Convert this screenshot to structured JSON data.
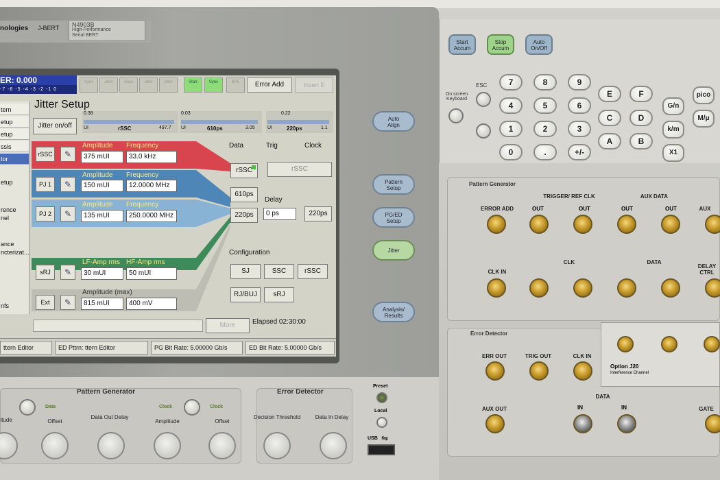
{
  "brand": {
    "name": "nologies",
    "product": "J-BERT",
    "model": "N4903B",
    "model_sub": "High-Performance",
    "serial_line": "Serial BERT"
  },
  "screen": {
    "ber_text": "ER: 0.000",
    "scale_text": "-7 -6 -5 -4 -3 -2 -1 0",
    "tabs": [
      "Sync",
      "Jitter",
      "Data",
      "Jitter",
      "Jitter",
      "Start",
      "Sync",
      "BPE"
    ],
    "error_add": "Error Add",
    "insert_label": "Insert E",
    "side_items": [
      "tern",
      "etup",
      "etup",
      "ssis",
      "tor",
      "etup",
      "rence",
      "nel",
      "ance",
      "ncterizat...",
      "nfs"
    ],
    "title": "Jitter Setup",
    "jitter_onoff": "Jitter on/off",
    "gauges": [
      {
        "lo": "0.38",
        "ui": "UI",
        "mid": "rSSC",
        "hi": "497.7"
      },
      {
        "lo": "0.03",
        "ui": "UI",
        "mid": "610ps",
        "hi": "3.05"
      },
      {
        "lo": "0.22",
        "ui": "UI",
        "mid": "220ps",
        "hi": "1.1"
      }
    ],
    "rows": [
      {
        "btn": "rSSC",
        "h1": "Amplitude",
        "h2": "Frequency",
        "v1": "375 mUI",
        "v2": "33.0 kHz",
        "color": "#d9454f"
      },
      {
        "btn": "PJ 1",
        "h1": "Amplitude",
        "h2": "Frequency",
        "v1": "150 mUI",
        "v2": "12.0000 MHz",
        "color": "#4f86b8"
      },
      {
        "btn": "PJ 2",
        "h1": "Amplitude",
        "h2": "Frequency",
        "v1": "135 mUI",
        "v2": "250.0000 MHz",
        "color": "#88b3d4"
      },
      {
        "btn": "sRJ",
        "h1": "LF-Amp rms",
        "h2": "HF-Amp rms",
        "v1": "30 mUI",
        "v2": "50 mUI",
        "color": "#3d8a5a"
      },
      {
        "btn": "Ext",
        "h1": "Amplitude (max)",
        "h2": "",
        "v1": "815 mUI",
        "v2": "400 mV",
        "color": "#bdbdb3"
      }
    ],
    "data_label": "Data",
    "trig_label": "Trig",
    "clock_label": "Clock",
    "rssc_btn": "rSSC",
    "rssc_wide": "rSSC",
    "ps610": "610ps",
    "ps220": "220ps",
    "delay_label": "Delay",
    "delay_value": "0 ps",
    "ps220b": "220ps",
    "configuration": "Configuration",
    "config_btns": [
      "SJ",
      "SSC",
      "rSSC",
      "RJ/BUJ",
      "sRJ"
    ],
    "more_btn": "More",
    "elapsed": "Elapsed 02:30:00",
    "status": [
      "ttern Editor",
      "ED Pttrn: ttern Editor",
      "PG Bit Rate: 5.00000 Gb/s",
      "ED Bit Rate: 5.00000 Gb/s"
    ]
  },
  "side_buttons": [
    {
      "label1": "Auto",
      "label2": "Align"
    },
    {
      "label1": "Pattern",
      "label2": "Setup"
    },
    {
      "label1": "PG/ED",
      "label2": "Setup"
    },
    {
      "label1": "Jitter",
      "label2": ""
    },
    {
      "label1": "Analysis/",
      "label2": "Results"
    }
  ],
  "top_buttons": [
    {
      "label1": "Start",
      "label2": "Accum"
    },
    {
      "label1": "Stop",
      "label2": "Accum"
    },
    {
      "label1": "Auto",
      "label2": "On/Off"
    }
  ],
  "keypad": {
    "numbers": [
      "7",
      "8",
      "9",
      "4",
      "5",
      "6",
      "1",
      "2",
      "3",
      "0",
      ".",
      "+/-"
    ],
    "hex": [
      "E",
      "F",
      "C",
      "D",
      "A",
      "B"
    ],
    "units": [
      "G/n",
      "k/m",
      "X1"
    ],
    "right": [
      "pico",
      "M/μ"
    ],
    "onscreen": "On screen Keyboard",
    "esc": "ESC"
  },
  "pattern_generator": {
    "title": "Pattern Generator",
    "labels": [
      "ERROR ADD",
      "TRIGGER/ REF CLK",
      "AUX DATA",
      "AUX",
      "CLK IN",
      "CLK",
      "DATA",
      "DELAY CTRL"
    ],
    "out": "OUT"
  },
  "error_detector": {
    "title": "Error Detector",
    "labels": [
      "ERR OUT",
      "TRIG OUT",
      "CLK IN",
      "AUX OUT",
      "DATA",
      "GATE"
    ],
    "in": "IN",
    "option": "Option J20",
    "option_sub": "Interference Channel"
  },
  "lower": {
    "pg_title": "Pattern Generator",
    "ed_title": "Error Detector",
    "knobs": [
      "Amplitude",
      "Offset",
      "Data Out Delay",
      "Amplitude",
      "Offset",
      "Decision Threshold",
      "Data In Delay"
    ],
    "data_label": "Data",
    "clock_label": "Clock",
    "preset": "Preset",
    "local": "Local",
    "usb": "USB"
  }
}
